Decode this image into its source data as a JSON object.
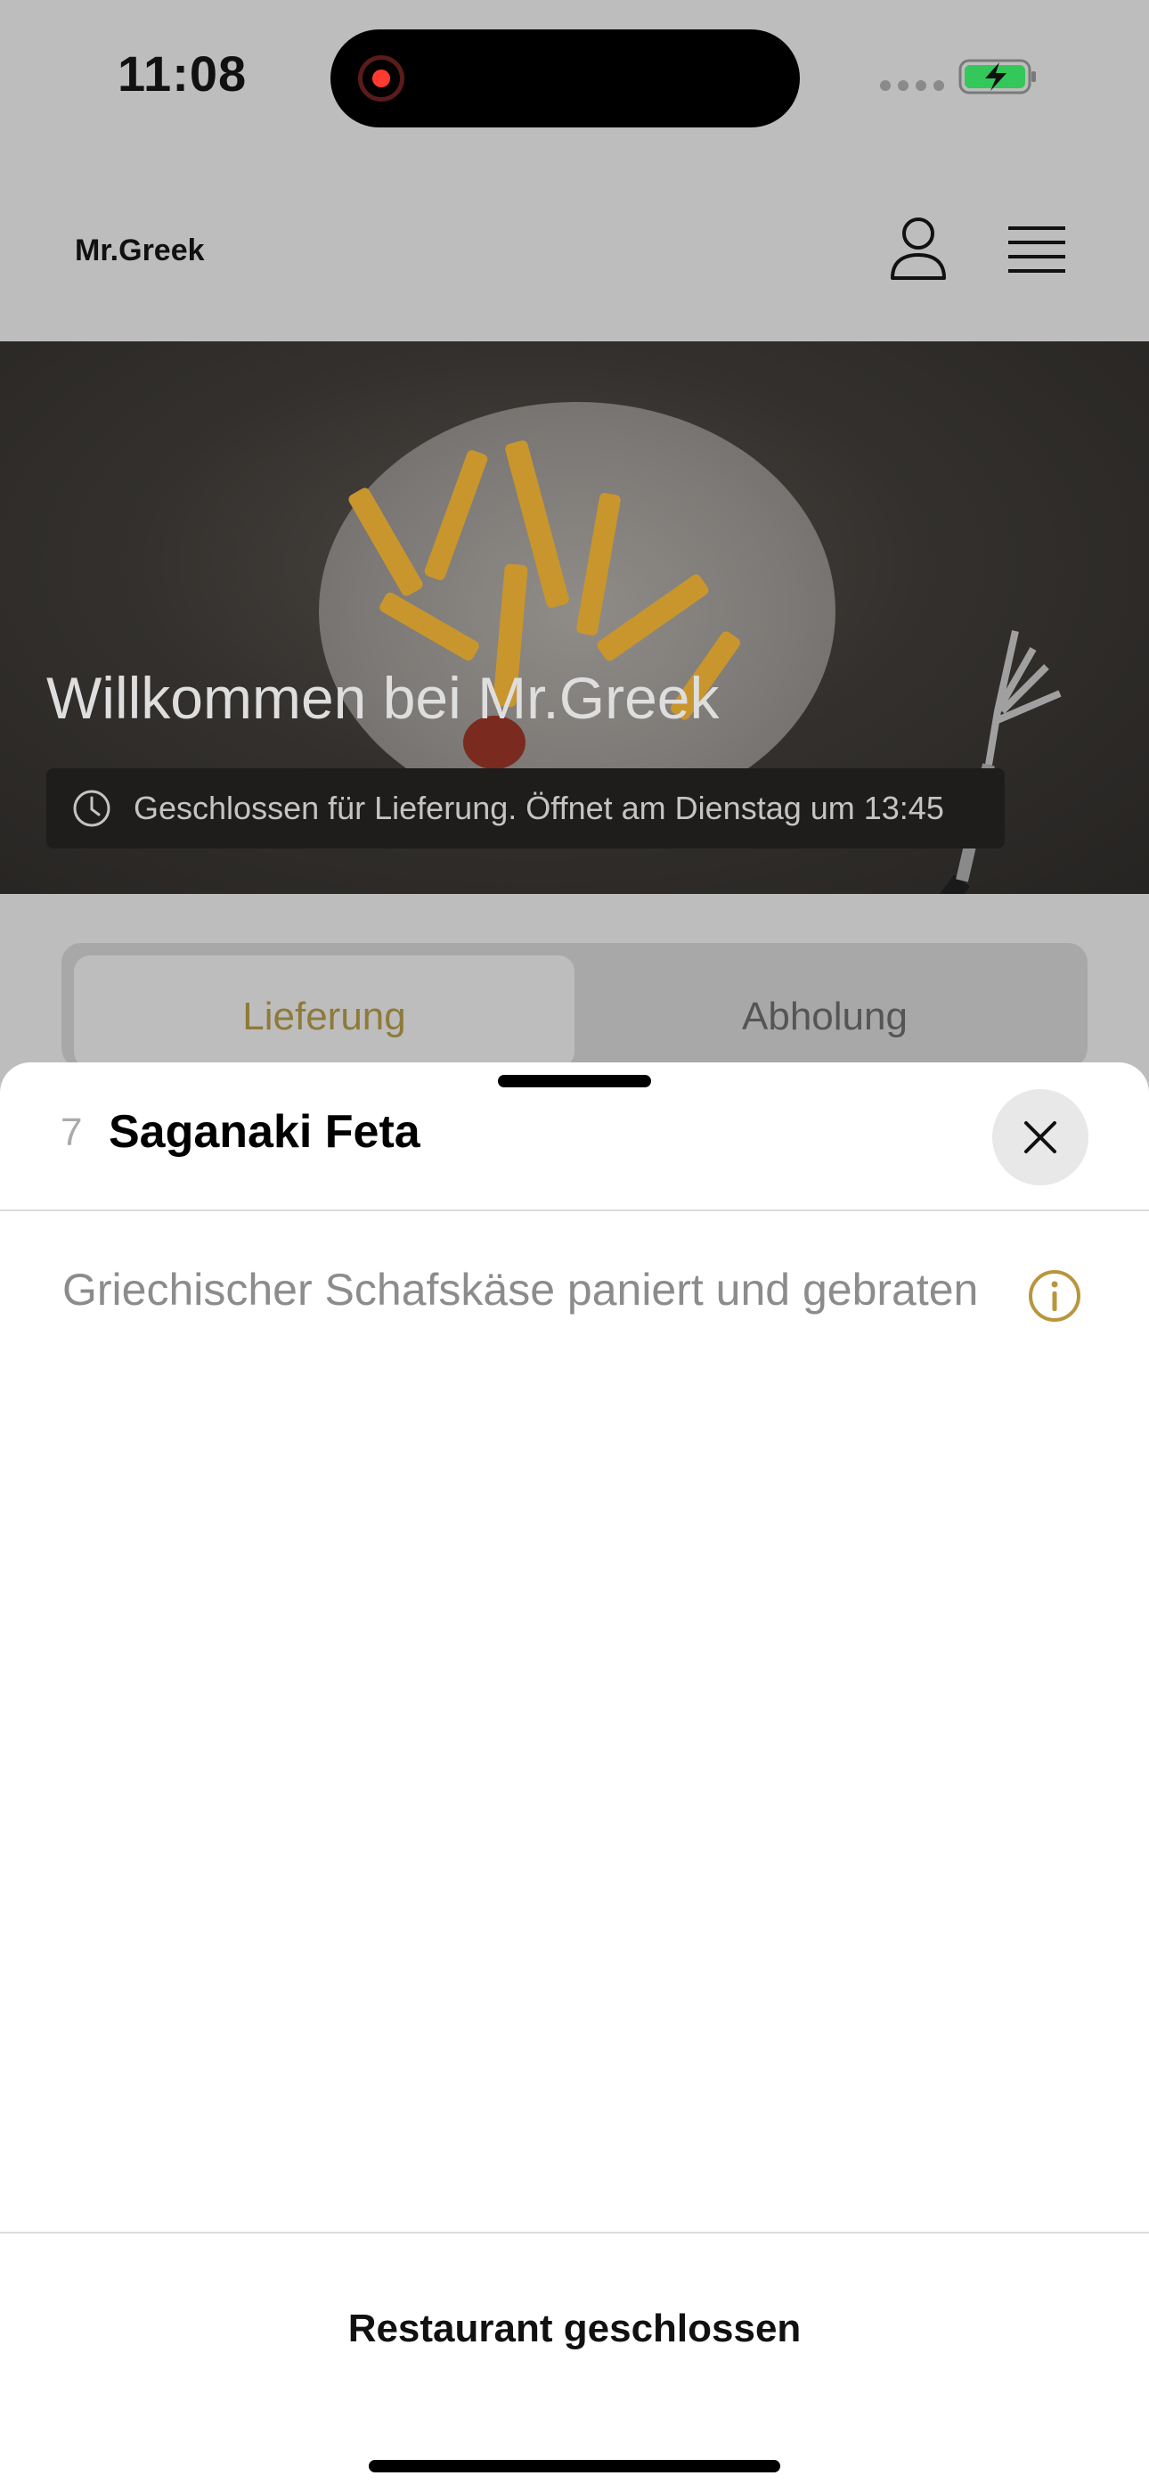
{
  "status_bar": {
    "time": "11:08"
  },
  "header": {
    "brand": "Mr.Greek"
  },
  "hero": {
    "title": "Willkommen bei Mr.Greek",
    "closed_notice": "Geschlossen für Lieferung. Öffnet am Dienstag um 13:45"
  },
  "tabs": [
    {
      "label": "Lieferung",
      "selected": true
    },
    {
      "label": "Abholung",
      "selected": false
    }
  ],
  "item": {
    "number": "7",
    "title": "Saganaki Feta",
    "description": "Griechischer Schafskäse paniert und gebraten"
  },
  "footer": {
    "label": "Restaurant geschlossen"
  },
  "colors": {
    "accent": "#b8963c",
    "battery_green": "#34c759",
    "sheet_bg": "#ffffff",
    "dim_bg": "#bdbdbd"
  },
  "icons": [
    "record-icon",
    "battery-icon",
    "user-icon",
    "menu-icon",
    "clock-icon",
    "close-icon",
    "info-icon",
    "fork-icon"
  ]
}
